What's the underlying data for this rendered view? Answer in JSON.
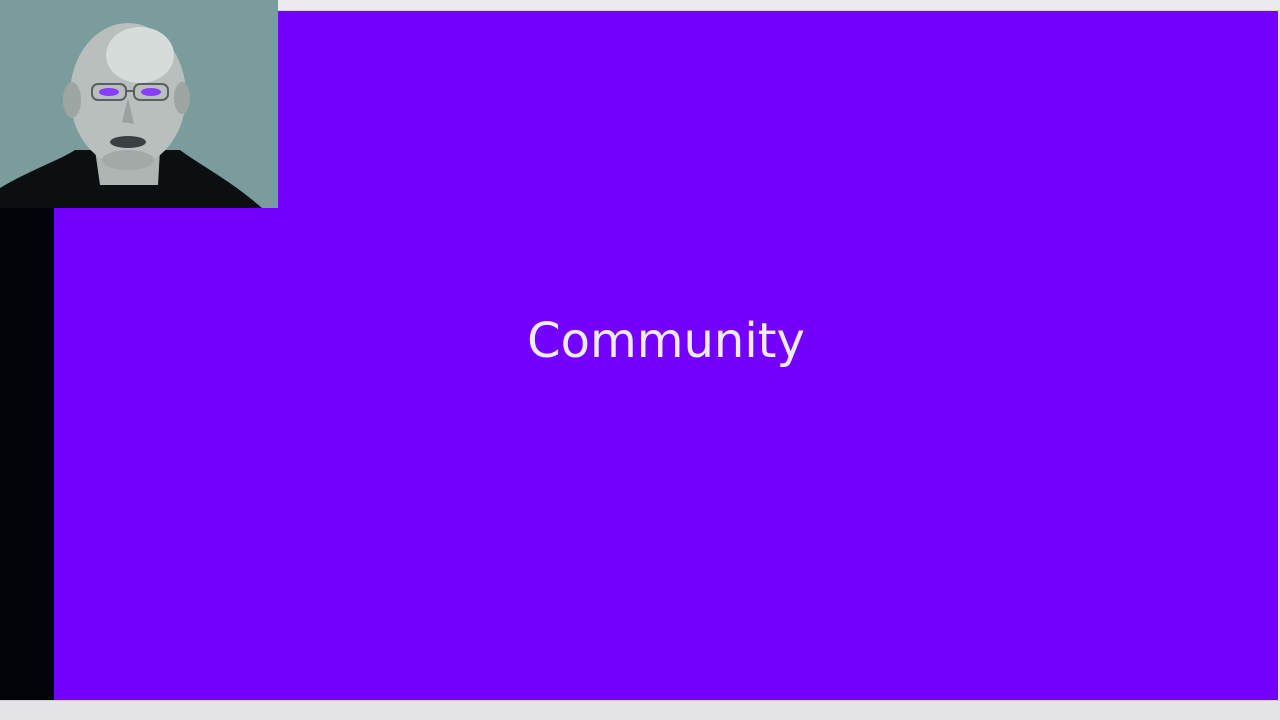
{
  "slide": {
    "title": "Community",
    "background_color": "#7400ff",
    "text_color": "#f0eaff"
  },
  "webcam": {
    "background_color": "#7a9c9c",
    "icon": "presenter-video-feed"
  }
}
